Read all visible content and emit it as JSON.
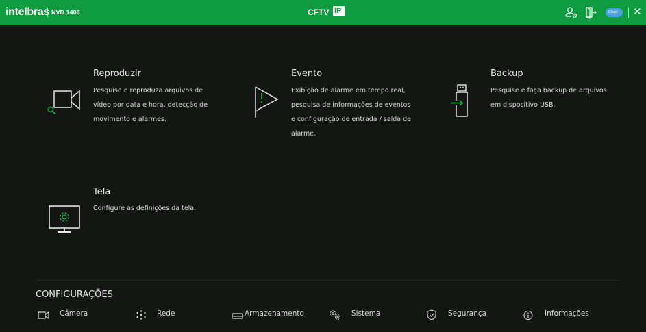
{
  "header": {
    "brand": "intelbras",
    "model": "NVD 1408",
    "center_label": "CFTV",
    "center_badge": "IP",
    "cloud_label": "Cloud",
    "close_glyph": "✕",
    "bar_color": "#0f9b3f"
  },
  "cards": [
    {
      "title": "Reproduzir",
      "lines": [
        "Pesquise e reproduza arquivos de",
        "vídeo por data e hora, detecção de",
        "movimento e alarmes."
      ],
      "icon": "video-playback-icon"
    },
    {
      "title": "Evento",
      "lines": [
        "Exibição de alarme em tempo real,",
        "pesquisa de informações de eventos",
        "e configuração de entrada / saída de",
        "alarme."
      ],
      "icon": "alarm-flag-icon"
    },
    {
      "title": "Backup",
      "lines": [
        "Pesquise e faça backup de arquivos",
        "em dispositivo USB."
      ],
      "icon": "usb-backup-icon"
    },
    {
      "title": "Tela",
      "lines": [
        "Configure as definições da tela."
      ],
      "icon": "monitor-settings-icon"
    }
  ],
  "config": {
    "title": "CONFIGURAÇÕES",
    "items": [
      {
        "label": "Câmera",
        "icon": "camera-icon"
      },
      {
        "label": "Rede",
        "icon": "network-icon"
      },
      {
        "label": "Armazenamento",
        "icon": "storage-icon"
      },
      {
        "label": "Sistema",
        "icon": "system-gears-icon"
      },
      {
        "label": "Segurança",
        "icon": "shield-icon"
      },
      {
        "label": "Informações",
        "icon": "info-icon"
      }
    ]
  }
}
